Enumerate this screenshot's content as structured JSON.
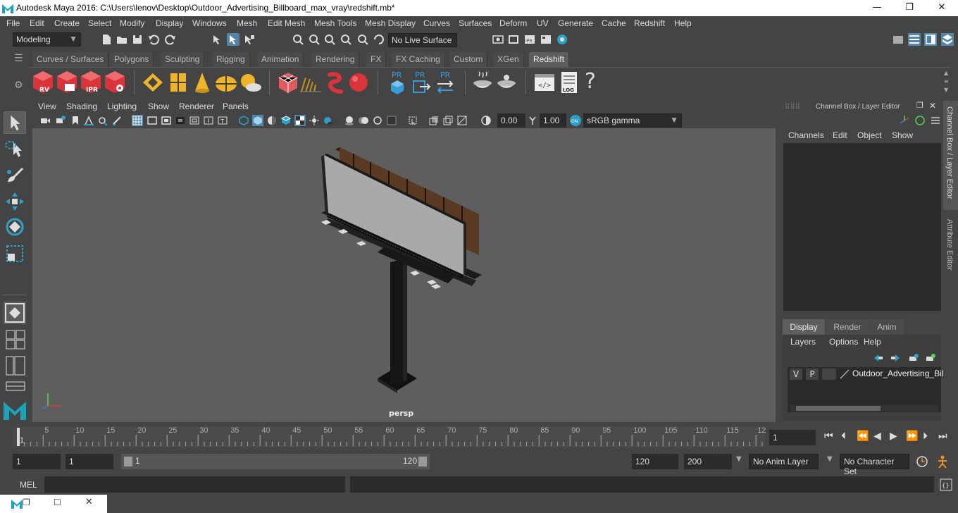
{
  "window": {
    "title": "Autodesk Maya 2016: C:\\Users\\lenov\\Desktop\\Outdoor_Advertising_Billboard_max_vray\\redshift.mb*",
    "minimize": "—",
    "maximize": "❐",
    "close": "✕"
  },
  "menus": [
    "File",
    "Edit",
    "Create",
    "Select",
    "Modify",
    "Display",
    "Windows",
    "Mesh",
    "Edit Mesh",
    "Mesh Tools",
    "Mesh Display",
    "Curves",
    "Surfaces",
    "Deform",
    "UV",
    "Generate",
    "Cache",
    "Redshift",
    "Help"
  ],
  "status": {
    "mode": "Modeling",
    "live_surface": "No Live Surface"
  },
  "shelf_tabs": [
    "Curves / Surfaces",
    "Polygons",
    "Sculpting",
    "Rigging",
    "Animation",
    "Rendering",
    "FX",
    "FX Caching",
    "Custom",
    "XGen",
    "Redshift"
  ],
  "shelf_active": "Redshift",
  "shelf_labels": {
    "rv": "RV",
    "ipr": "IPR",
    "pr": "PR",
    "log": "LOG",
    "help": "?"
  },
  "viewport": {
    "menus": [
      "View",
      "Shading",
      "Lighting",
      "Show",
      "Renderer",
      "Panels"
    ],
    "exposure": "0.00",
    "gamma": "1.00",
    "color_space": "sRGB gamma",
    "camera_label": "persp"
  },
  "channel_box": {
    "header": "Channel Box / Layer Editor",
    "menus": [
      "Channels",
      "Edit",
      "Object",
      "Show"
    ],
    "layer_tabs": [
      "Display",
      "Render",
      "Anim"
    ],
    "layer_tab_active": "Display",
    "layer_menus": [
      "Layers",
      "Options",
      "Help"
    ],
    "layer": {
      "v": "V",
      "p": "P",
      "name": "Outdoor_Advertising_Bil"
    }
  },
  "side_tabs": [
    "Channel Box / Layer Editor",
    "Attribute Editor"
  ],
  "timeline": {
    "ticks": [
      "1",
      "5",
      "10",
      "15",
      "20",
      "25",
      "30",
      "35",
      "40",
      "45",
      "50",
      "55",
      "60",
      "65",
      "70",
      "75",
      "80",
      "85",
      "90",
      "95",
      "100",
      "105",
      "110",
      "115",
      "12"
    ],
    "current_frame": "1"
  },
  "range": {
    "start": "1",
    "playback_start": "1",
    "slider_start": "1",
    "slider_end": "120",
    "playback_end": "120",
    "end": "200",
    "anim_layer": "No Anim Layer",
    "character_set": "No Character Set"
  },
  "command": {
    "label": "MEL"
  },
  "colors": {
    "accent": "#5285a6",
    "redshift_red": "#d9343a",
    "shelf_yellow": "#f0b429",
    "pr_blue": "#3a9bd9"
  }
}
